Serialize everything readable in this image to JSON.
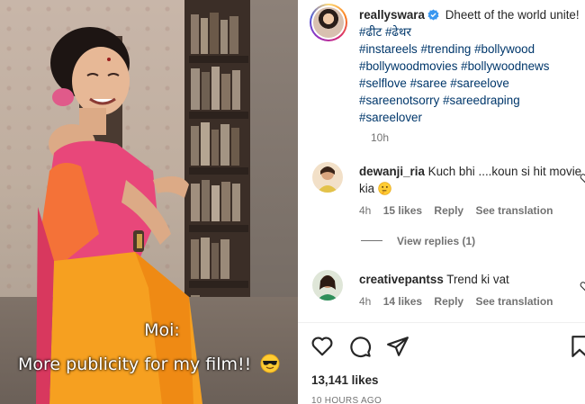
{
  "media": {
    "caption_line1": "Moi:",
    "caption_line2": "More publicity for my film!!",
    "caption_emoji": "sunglasses-emoji"
  },
  "post": {
    "username": "reallyswara",
    "verified": true,
    "caption_text": "Dheett of the world unite!",
    "hashtags": [
      "#ढीट",
      "#ढेथर",
      "#instareels",
      "#trending",
      "#bollywood",
      "#bollywoodmovies",
      "#bollywoodnews",
      "#selflove",
      "#saree",
      "#sareelove",
      "#sareenotsorry",
      "#sareedraping",
      "#sareelover"
    ],
    "time": "10h"
  },
  "comments": [
    {
      "username": "dewanji_ria",
      "text": "Kuch bhi ....koun si hit movie kia",
      "emoji": "thinking-face-emoji",
      "time": "4h",
      "likes": "15 likes",
      "reply": "Reply",
      "translate": "See translation",
      "view_replies": "View replies (1)"
    },
    {
      "username": "creativepantss",
      "text": "Trend ki vat",
      "time": "4h",
      "likes": "14 likes",
      "reply": "Reply",
      "translate": "See translation"
    }
  ],
  "footer": {
    "likes": "13,141 likes",
    "date": "10 HOURS AGO"
  },
  "colors": {
    "link": "#00376b",
    "muted": "#737373",
    "text": "#262626"
  }
}
